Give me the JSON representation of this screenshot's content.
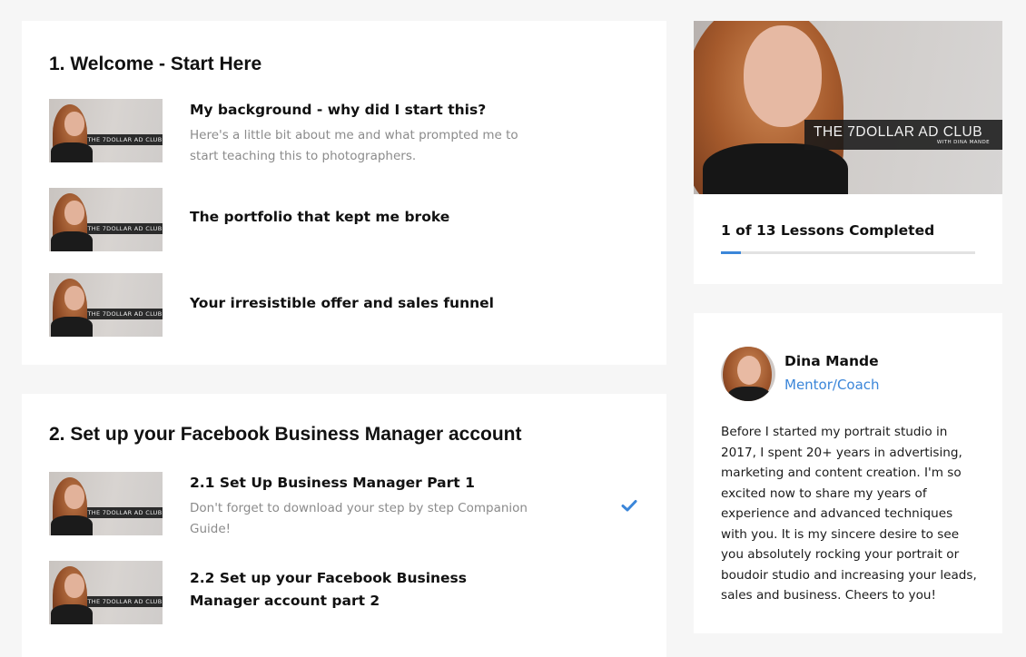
{
  "modules": [
    {
      "title": "1. Welcome - Start Here",
      "lessons": [
        {
          "title": "My background - why did I start this?",
          "description": "Here's a little bit about me and what prompted me to start teaching this to photographers.",
          "completed": false
        },
        {
          "title": "The portfolio that kept me broke",
          "completed": false
        },
        {
          "title": "Your irresistible offer and sales funnel",
          "completed": false
        }
      ]
    },
    {
      "title": "2. Set up your Facebook Business Manager account",
      "lessons": [
        {
          "title": "2.1 Set Up Business Manager Part 1",
          "description": "Don't forget to download your step by step Companion Guide!",
          "completed": true
        },
        {
          "title": "2.2 Set up your Facebook Business Manager account part 2",
          "completed": false
        }
      ]
    }
  ],
  "thumbnail_brand": "THE 7DOLLAR AD CLUB",
  "course": {
    "brand_title": "THE 7DOLLAR AD CLUB",
    "brand_subtitle": "WITH DINA MANDE",
    "progress_text": "1 of 13 Lessons Completed",
    "lessons_completed": 1,
    "lessons_total": 13
  },
  "author": {
    "name": "Dina Mande",
    "role": "Mentor/Coach",
    "bio": "Before I started my portrait studio in 2017, I spent 20+ years in advertising, marketing and content creation. I'm so excited now to share my years of experience and advanced techniques with you. It is my sincere desire to see you absolutely rocking your portrait or boudoir studio and increasing your leads, sales and business. Cheers to you!"
  },
  "colors": {
    "accent": "#3b86d9",
    "background": "#f6f6f6",
    "card": "#ffffff"
  },
  "icons": {
    "completed": "checkmark-icon"
  }
}
